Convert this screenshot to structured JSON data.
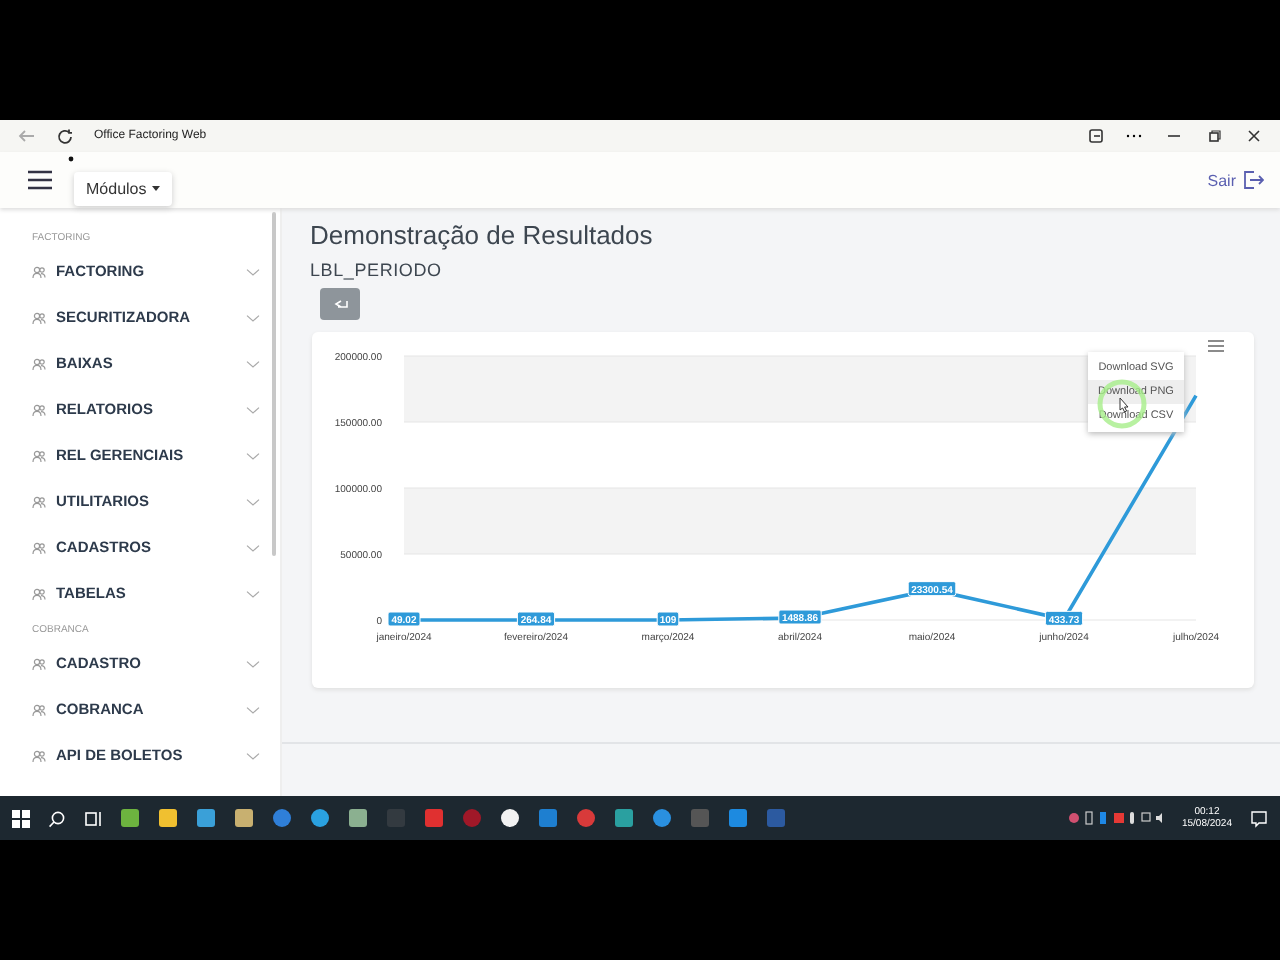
{
  "browser": {
    "title": "Office Factoring Web"
  },
  "header": {
    "modules_button": "Módulos",
    "logout": "Sair"
  },
  "sidebar": {
    "sections": [
      {
        "title": "FACTORING",
        "items": [
          {
            "label": "FACTORING",
            "expanded": false
          },
          {
            "label": "SECURITIZADORA",
            "expanded": false
          },
          {
            "label": "BAIXAS",
            "expanded": false
          },
          {
            "label": "RELATORIOS",
            "expanded": false
          },
          {
            "label": "REL GERENCIAIS",
            "expanded": false
          },
          {
            "label": "UTILITARIOS",
            "expanded": false
          },
          {
            "label": "CADASTROS",
            "expanded": false
          },
          {
            "label": "TABELAS",
            "expanded": false
          }
        ]
      },
      {
        "title": "COBRANCA",
        "items": [
          {
            "label": "CADASTRO",
            "expanded": false
          },
          {
            "label": "COBRANCA",
            "expanded": false
          },
          {
            "label": "API DE BOLETOS",
            "expanded": false
          }
        ]
      }
    ]
  },
  "page": {
    "title": "Demonstração de Resultados",
    "period_label": "LBL_PERIODO"
  },
  "chart": {
    "chart_data": {
      "type": "line",
      "categories": [
        "janeiro/2024",
        "fevereiro/2024",
        "março/2024",
        "abril/2024",
        "maio/2024",
        "junho/2024",
        "julho/2024"
      ],
      "series": [
        {
          "color": "#2e9ad9",
          "values": [
            0,
            0,
            0,
            1500,
            23000,
            500,
            170000
          ]
        }
      ],
      "ylim": [
        0,
        200000
      ],
      "grid": true,
      "yticks": [
        {
          "value": 0,
          "label": "0"
        },
        {
          "value": 50000,
          "label": "50000.00"
        },
        {
          "value": 100000,
          "label": "100000.00"
        },
        {
          "value": 150000,
          "label": "150000.00"
        },
        {
          "value": 200000,
          "label": "200000.00"
        }
      ],
      "value_labels": [
        "49.02",
        "264.84",
        "109",
        "1488.86",
        "23300.54",
        "433.73",
        null
      ]
    },
    "menu": [
      {
        "label": "Download SVG",
        "selected": false
      },
      {
        "label": "Download PNG",
        "selected": true
      },
      {
        "label": "Download CSV",
        "selected": false
      }
    ]
  },
  "taskbar": {
    "time": "00:12",
    "date": "15/08/2024"
  }
}
